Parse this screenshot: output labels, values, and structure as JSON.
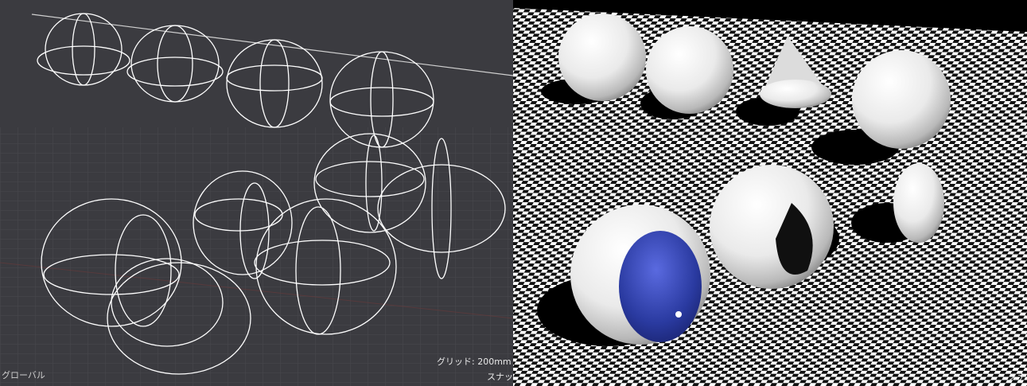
{
  "left_viewport": {
    "coordinate_mode": "グローバル",
    "grid_readout": "グリッド: 200mm /",
    "snap_readout": "スナップ:",
    "background_color": "#3b3b40",
    "wire_color": "#ffffff"
  },
  "right_viewport": {
    "snap_readout": "スナ",
    "floor_pattern": "checkerboard",
    "floor_colors": [
      "#ffffff",
      "#111111"
    ],
    "object_color": "#f2f2f2",
    "accent_color": "#2a3aa0"
  }
}
